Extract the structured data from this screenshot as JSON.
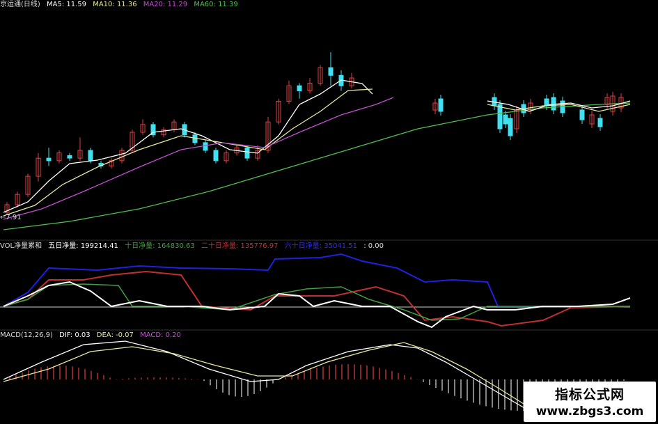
{
  "colors": {
    "ma5": "#ffffff",
    "ma10": "#e8e8a0",
    "ma20": "#c050d0",
    "ma60": "#50c050",
    "up": "#e04040",
    "down": "#40e0f0",
    "vol_blue": "#2020e0",
    "vol_red": "#c03030",
    "vol_green": "#40a040",
    "vol_white": "#ffffff"
  },
  "main_header": {
    "title": "京运通(日线)",
    "ma5": "MA5: 11.59",
    "ma10": "MA10: 11.36",
    "ma20": "MA20: 11.29",
    "ma60": "MA60: 11.39"
  },
  "low_label": "7.91",
  "vol_header": {
    "name": "VOL净量累和",
    "five": "五日净量: 199214.41",
    "ten": "十日净量: 164830.63",
    "twenty": "二十日净量: 135776.97",
    "sixty": "六十日净量: 35041.51",
    "zero": ": 0.00"
  },
  "macd_header": {
    "name": "MACD(12,26,9)",
    "dif": "DIF: 0.03",
    "dea": "DEA: -0.07",
    "macd": "MACD: 0.20"
  },
  "watermark": {
    "line1": "指标公式网",
    "line2": "www.zbgs3.com"
  },
  "series": {
    "candles": [
      [
        2,
        7.9,
        8.2,
        7.8,
        8.3
      ],
      [
        3,
        8.2,
        8.6,
        8.1,
        8.7
      ],
      [
        4,
        8.6,
        9.3,
        8.5,
        9.4
      ],
      [
        5,
        9.3,
        10.0,
        9.1,
        10.2
      ],
      [
        6,
        10.0,
        9.9,
        9.7,
        10.4
      ],
      [
        7,
        9.9,
        10.2,
        9.8,
        10.3
      ],
      [
        8,
        10.1,
        10.0,
        9.9,
        10.2
      ],
      [
        9,
        10.0,
        10.3,
        9.9,
        10.8
      ],
      [
        10,
        10.3,
        9.9,
        9.8,
        10.4
      ],
      [
        11,
        9.8,
        9.7,
        9.6,
        9.9
      ],
      [
        12,
        9.7,
        9.9,
        9.6,
        10.0
      ],
      [
        13,
        9.9,
        10.3,
        9.8,
        10.4
      ],
      [
        14,
        10.3,
        11.0,
        10.2,
        11.1
      ],
      [
        15,
        11.0,
        11.3,
        10.9,
        11.5
      ],
      [
        16,
        11.3,
        10.9,
        10.8,
        11.4
      ],
      [
        17,
        10.9,
        11.1,
        10.8,
        11.2
      ],
      [
        18,
        11.1,
        11.4,
        11.0,
        11.5
      ],
      [
        19,
        11.3,
        10.9,
        10.8,
        11.4
      ],
      [
        20,
        10.9,
        10.6,
        10.5,
        11.0
      ],
      [
        21,
        10.6,
        10.3,
        10.2,
        10.7
      ],
      [
        22,
        10.3,
        9.9,
        9.8,
        10.4
      ],
      [
        23,
        9.9,
        10.2,
        9.8,
        10.3
      ],
      [
        24,
        10.2,
        10.4,
        10.1,
        10.5
      ],
      [
        25,
        10.4,
        10.0,
        9.9,
        10.5
      ],
      [
        26,
        10.0,
        10.3,
        9.9,
        10.5
      ],
      [
        27,
        10.3,
        11.4,
        10.2,
        11.6
      ],
      [
        28,
        11.4,
        12.2,
        11.3,
        12.3
      ],
      [
        29,
        12.2,
        12.8,
        12.1,
        13.0
      ],
      [
        30,
        12.8,
        12.6,
        12.3,
        12.9
      ],
      [
        31,
        12.6,
        12.9,
        12.5,
        13.1
      ],
      [
        32,
        12.9,
        13.5,
        12.8,
        13.6
      ],
      [
        33,
        13.5,
        13.2,
        12.8,
        14.1
      ],
      [
        34,
        13.2,
        12.8,
        12.6,
        13.4
      ],
      [
        35,
        12.8,
        13.1,
        12.7,
        13.3
      ]
    ]
  }
}
